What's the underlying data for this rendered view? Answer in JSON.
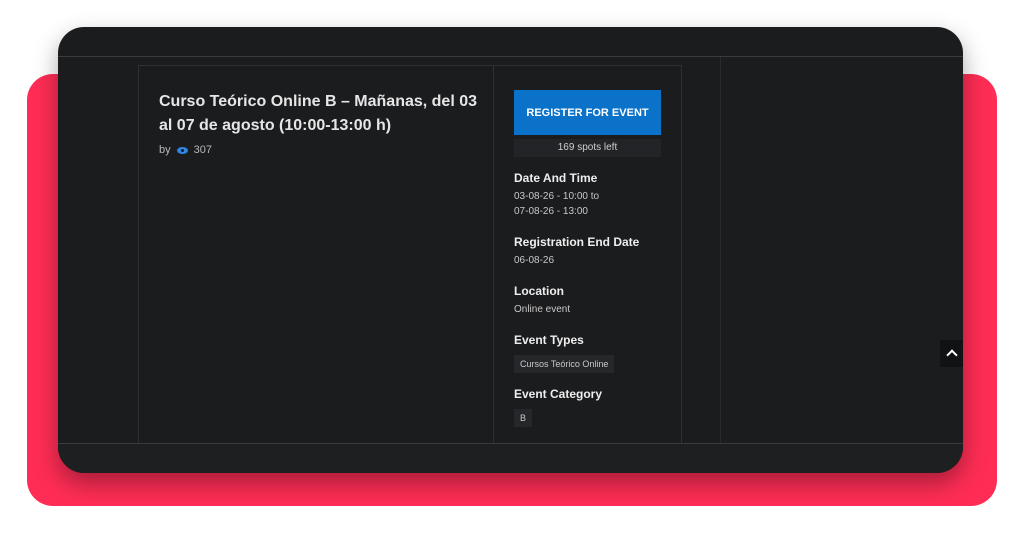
{
  "event": {
    "title": "Curso Teórico Online B – Mañanas, del 03 al 07 de agosto (10:00-13:00 h)",
    "by_label": "by",
    "views": "307"
  },
  "sidebar": {
    "register_label": "REGISTER FOR EVENT",
    "spots_left": "169 spots left",
    "date_time": {
      "title": "Date And Time",
      "start": "03-08-26 - 10:00 to",
      "end": "07-08-26 - 13:00"
    },
    "registration_end": {
      "title": "Registration End Date",
      "value": "06-08-26"
    },
    "location": {
      "title": "Location",
      "value": "Online event"
    },
    "event_types": {
      "title": "Event Types",
      "tag": "Cursos Teórico Online"
    },
    "event_category": {
      "title": "Event Category",
      "tag": "B"
    }
  },
  "icons": {
    "views": "eye-icon",
    "scroll_top": "chevron-up-icon"
  },
  "colors": {
    "accent_card": "#ff2d55",
    "register_button": "#0a72c9",
    "background": "#1b1c1e"
  }
}
